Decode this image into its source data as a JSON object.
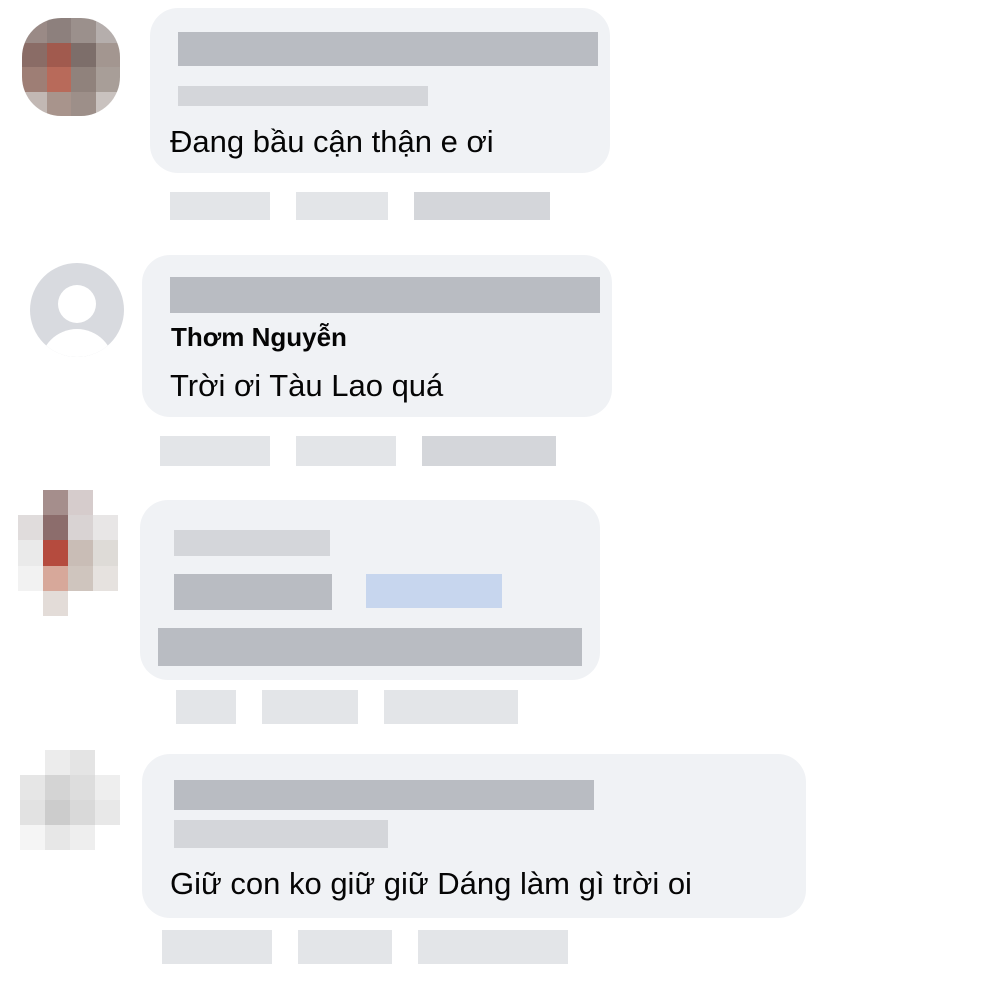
{
  "comments": [
    {
      "author": "",
      "text": "Đang bầu cận thận e ơi"
    },
    {
      "author": "Thơm Nguyễn",
      "text": "Trời ơi Tàu Lao quá"
    },
    {
      "author": "",
      "text": ""
    },
    {
      "author": "",
      "text": "Giữ con ko giữ giữ Dáng làm gì trời oi"
    }
  ],
  "icons": {
    "default_avatar": "default-profile-icon"
  }
}
